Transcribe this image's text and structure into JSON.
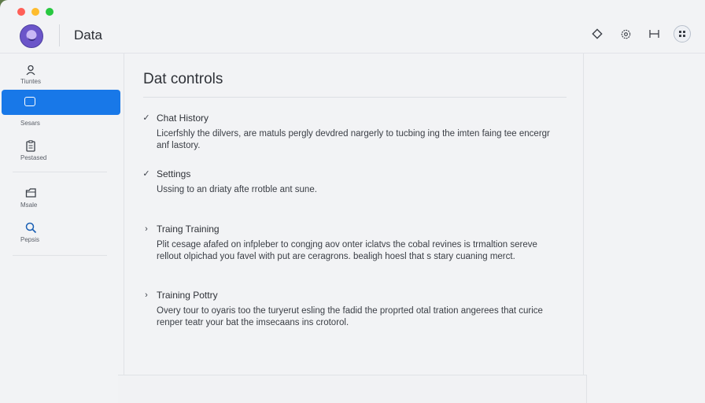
{
  "header": {
    "title": "Data",
    "icons": [
      "diamond-icon",
      "gear-icon",
      "expand-icon",
      "grid-icon"
    ]
  },
  "sidebar": {
    "items": [
      {
        "label": "Tiuntes",
        "icon": "user-icon"
      },
      {
        "label": "",
        "icon": "window-icon",
        "active": true
      },
      {
        "label": "Sesars",
        "icon": ""
      },
      {
        "label": "Pestased",
        "icon": "clipboard-icon"
      },
      {
        "label": "Msale",
        "icon": "folder-icon"
      },
      {
        "label": "Pepsis",
        "icon": "search-icon"
      }
    ]
  },
  "main": {
    "title": "Dat controls",
    "settings": [
      {
        "toggle": "✓",
        "name": "Chat History",
        "desc": "Licerfshly the dilvers, are matuls pergly devdred nargerly to tucbing ing the imten faing tee encergr anf lastory."
      },
      {
        "toggle": "✓",
        "name": "Settings",
        "desc": "Ussing to an driaty afte rrotble ant sune."
      },
      {
        "toggle": "›",
        "name": "Traing Training",
        "desc": "Plit cesage afafed on infpleber to congjng aov onter iclatvs the cobal revines is trmaltion sereve rellout olpichad you favel with put are ceragrons. bealigh hoesl that s stary cuaning merct."
      },
      {
        "toggle": "›",
        "name": "Training Pottry",
        "desc": "Overy tour to oyaris too the turyerut esling the fadid the proprted otal tration angerees that curice renper teatr your bat the imsecaans ins crotorol."
      }
    ]
  }
}
